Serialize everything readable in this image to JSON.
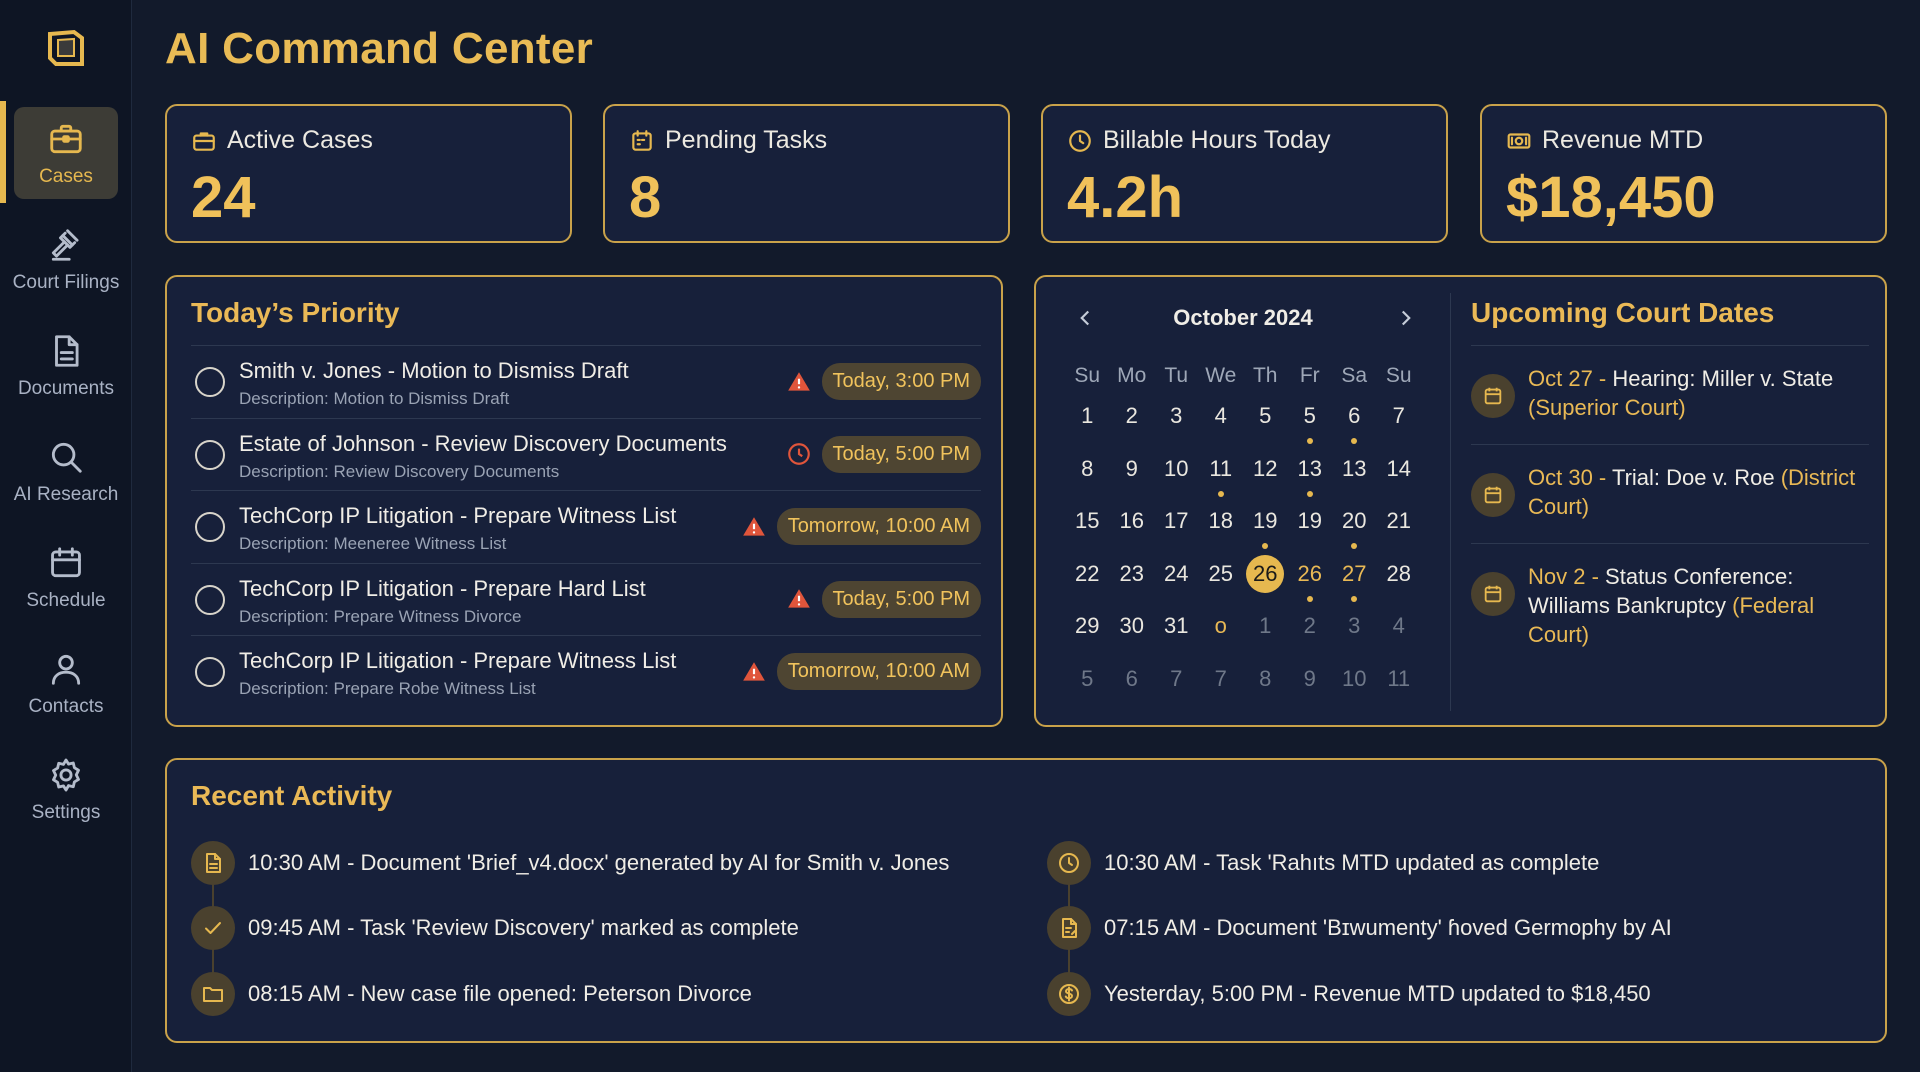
{
  "colors": {
    "accent": "#e6b84f",
    "background": "#121a2b",
    "card": "#17203a",
    "alert": "#e0553b"
  },
  "app": {
    "title": "AI Command Center",
    "logo_icon": "logo-icon"
  },
  "sidebar": {
    "items": [
      {
        "label": "Cases",
        "icon": "briefcase-icon",
        "active": true
      },
      {
        "label": "Court Filings",
        "icon": "gavel-icon"
      },
      {
        "label": "Documents",
        "icon": "document-icon"
      },
      {
        "label": "AI Research",
        "icon": "search-icon"
      },
      {
        "label": "Schedule",
        "icon": "calendar-icon"
      },
      {
        "label": "Contacts",
        "icon": "user-icon"
      },
      {
        "label": "Settings",
        "icon": "gear-icon"
      }
    ]
  },
  "stats": [
    {
      "label": "Active Cases",
      "value": "24",
      "icon": "briefcase-icon"
    },
    {
      "label": "Pending Tasks",
      "value": "8",
      "icon": "calendar-icon"
    },
    {
      "label": "Billable Hours Today",
      "value": "4.2h",
      "icon": "clock-icon"
    },
    {
      "label": "Revenue MTD",
      "value": "$18,450",
      "icon": "cash-icon"
    }
  ],
  "priority": {
    "title": "Today’s Priority",
    "items": [
      {
        "title": "Smith v. Jones - Motion to Dismiss Draft",
        "desc": "Description: Motion to Dismiss Draft",
        "due": "Today, 3:00 PM",
        "flag": "warning-icon"
      },
      {
        "title": "Estate of Johnson - Review Discovery Documents",
        "desc": "Description: Review Discovery Documents",
        "due": "Today, 5:00 PM",
        "flag": "clock-alert-icon"
      },
      {
        "title": "TechCorp IP Litigation - Prepare Witness List",
        "desc": "Description: Meeneree Witness List",
        "due": "Tomorrow, 10:00 AM",
        "flag": "warning-icon"
      },
      {
        "title": "TechCorp IP Litigation - Prepare Hard List",
        "desc": "Description: Prepare Witness Divorce",
        "due": "Today, 5:00 PM",
        "flag": "warning-icon"
      },
      {
        "title": "TechCorp IP Litigation - Prepare Witness List",
        "desc": "Description: Prepare Robe Witness List",
        "due": "Tomorrow, 10:00 AM",
        "flag": "warning-icon"
      }
    ]
  },
  "calendar": {
    "month": "October 2024",
    "weekdays": [
      "Su",
      "Mo",
      "Tu",
      "We",
      "Th",
      "Fr",
      "Sa",
      "Su"
    ],
    "weeks": [
      [
        {
          "d": "1"
        },
        {
          "d": "2"
        },
        {
          "d": "3"
        },
        {
          "d": "4"
        },
        {
          "d": "5"
        },
        {
          "d": "5",
          "dot": true
        },
        {
          "d": "6",
          "dot": true
        },
        {
          "d": "7"
        }
      ],
      [
        {
          "d": "8"
        },
        {
          "d": "9"
        },
        {
          "d": "10"
        },
        {
          "d": "11",
          "dot": true
        },
        {
          "d": "12"
        },
        {
          "d": "13",
          "dot": true
        },
        {
          "d": "13"
        },
        {
          "d": "14"
        }
      ],
      [
        {
          "d": "15"
        },
        {
          "d": "16"
        },
        {
          "d": "17"
        },
        {
          "d": "18"
        },
        {
          "d": "19",
          "dot": true
        },
        {
          "d": "19"
        },
        {
          "d": "20",
          "dot": true
        },
        {
          "d": "21"
        }
      ],
      [
        {
          "d": "22"
        },
        {
          "d": "23"
        },
        {
          "d": "24"
        },
        {
          "d": "25"
        },
        {
          "d": "26",
          "today": true
        },
        {
          "d": "26",
          "gold": true,
          "dot": true
        },
        {
          "d": "27",
          "gold": true,
          "dot": true
        },
        {
          "d": "28"
        }
      ],
      [
        {
          "d": "29"
        },
        {
          "d": "30"
        },
        {
          "d": "31"
        },
        {
          "d": "o",
          "muted": true,
          "gold": true
        },
        {
          "d": "1",
          "muted": true
        },
        {
          "d": "2",
          "muted": true
        },
        {
          "d": "3",
          "muted": true
        },
        {
          "d": "4",
          "muted": true
        }
      ],
      [
        {
          "d": "5",
          "muted": true
        },
        {
          "d": "6",
          "muted": true
        },
        {
          "d": "7",
          "muted": true
        },
        {
          "d": "7",
          "muted": true
        },
        {
          "d": "8",
          "muted": true
        },
        {
          "d": "9",
          "muted": true
        },
        {
          "d": "10",
          "muted": true
        },
        {
          "d": "11",
          "muted": true
        }
      ]
    ]
  },
  "court_dates": {
    "title": "Upcoming Court Dates",
    "items": [
      {
        "date": "Oct 27",
        "sep": " - ",
        "event": "Hearing: Miller v. State ",
        "court": "(Superior Court)"
      },
      {
        "date": "Oct 30",
        "sep": " - ",
        "event": "Trial: Doe v. Roe ",
        "court": "(District Court)"
      },
      {
        "date": "Nov 2",
        "sep": " - ",
        "event": "Status Conference: Williams Bankruptcy ",
        "court": "(Federal Court)"
      }
    ]
  },
  "activity": {
    "title": "Recent Activity",
    "left": [
      {
        "text": "10:30 AM - Document 'Brief_v4.docx' generated by AI for Smith v. Jones",
        "icon": "document-icon"
      },
      {
        "text": "09:45 AM - Task 'Review Discovery' marked as complete",
        "icon": "check-icon"
      },
      {
        "text": "08:15 AM - New case file opened: Peterson Divorce",
        "icon": "folder-icon"
      }
    ],
    "right": [
      {
        "text": "10:30 AM - Task 'Rahıts MTD updated as complete",
        "icon": "clock-icon"
      },
      {
        "text": "07:15 AM - Document 'Bɪwumenty' ɦoved Germophy by AI",
        "icon": "document-edit-icon"
      },
      {
        "text": "Yesterday, 5:00 PM - Revenue MTD updated to $18,450",
        "icon": "dollar-icon"
      }
    ]
  }
}
